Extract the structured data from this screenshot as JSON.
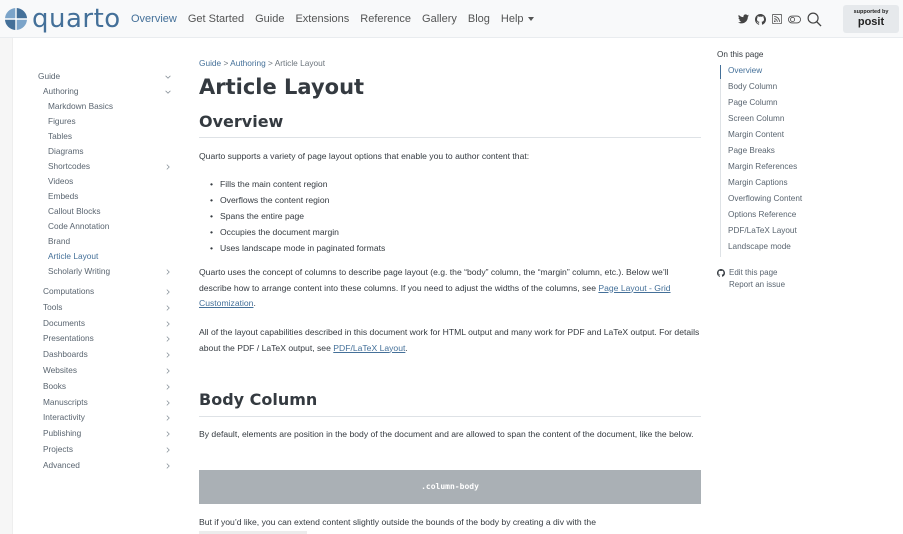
{
  "navbar": {
    "brand": "quarto",
    "links": [
      "Overview",
      "Get Started",
      "Guide",
      "Extensions",
      "Reference",
      "Gallery",
      "Blog",
      "Help"
    ],
    "active_link": "Overview",
    "icons": [
      "twitter-icon",
      "github-icon",
      "rss-icon",
      "reader-mode-toggle-icon",
      "search-icon"
    ],
    "badge_small": "supported by",
    "badge_big": "posit"
  },
  "sidebar": {
    "items": [
      {
        "label": "Guide",
        "level": 0,
        "chevron": "down"
      },
      {
        "label": "Authoring",
        "level": 1,
        "chevron": "down"
      },
      {
        "label": "Markdown Basics",
        "level": 2
      },
      {
        "label": "Figures",
        "level": 2
      },
      {
        "label": "Tables",
        "level": 2
      },
      {
        "label": "Diagrams",
        "level": 2
      },
      {
        "label": "Shortcodes",
        "level": 2,
        "chevron": "right"
      },
      {
        "label": "Videos",
        "level": 2
      },
      {
        "label": "Embeds",
        "level": 2
      },
      {
        "label": "Callout Blocks",
        "level": 2
      },
      {
        "label": "Code Annotation",
        "level": 2
      },
      {
        "label": "Brand",
        "level": 2
      },
      {
        "label": "Article Layout",
        "level": 2,
        "active": true
      },
      {
        "label": "Scholarly Writing",
        "level": 2,
        "chevron": "right"
      },
      {
        "label": "Computations",
        "level": 1,
        "chevron": "right"
      },
      {
        "label": "Tools",
        "level": 1,
        "chevron": "right"
      },
      {
        "label": "Documents",
        "level": 1,
        "chevron": "right"
      },
      {
        "label": "Presentations",
        "level": 1,
        "chevron": "right"
      },
      {
        "label": "Dashboards",
        "level": 1,
        "chevron": "right"
      },
      {
        "label": "Websites",
        "level": 1,
        "chevron": "right"
      },
      {
        "label": "Books",
        "level": 1,
        "chevron": "right"
      },
      {
        "label": "Manuscripts",
        "level": 1,
        "chevron": "right"
      },
      {
        "label": "Interactivity",
        "level": 1,
        "chevron": "right"
      },
      {
        "label": "Publishing",
        "level": 1,
        "chevron": "right"
      },
      {
        "label": "Projects",
        "level": 1,
        "chevron": "right"
      },
      {
        "label": "Advanced",
        "level": 1,
        "chevron": "right"
      }
    ]
  },
  "main": {
    "breadcrumb": [
      "Guide",
      "Authoring",
      "Article Layout"
    ],
    "breadcrumb_sep": ">",
    "title": "Article Layout",
    "overview_heading": "Overview",
    "intro": "Quarto supports a variety of page layout options that enable you to author content that:",
    "bullets": [
      "Fills the main content region",
      "Overflows the content region",
      "Spans the entire page",
      "Occupies the document margin",
      "Uses landscape mode in paginated formats"
    ],
    "columns_para_1": "Quarto uses the concept of columns to describe page layout (e.g. the “body” column, the “margin” column, etc.). Below we’ll describe how to arrange content into these columns. If you need to adjust the widths of the columns, see ",
    "columns_link": "Page Layout - Grid Customization",
    "columns_para_end": ".",
    "capabilities_para": "All of the layout capabilities described in this document work for HTML output and many work for PDF and LaTeX output. For details about the PDF / LaTeX output, see ",
    "capabilities_link": "PDF/LaTeX Layout",
    "capabilities_end": ".",
    "body_heading": "Body Column",
    "body_para": "By default, elements are position in the body of the document and are allowed to span the content of the document, like the below.",
    "body_demo": ".column-body",
    "extend_para": "But if you’d like, you can extend content slightly outside the bounds of the body by creating a div with the"
  },
  "toc": {
    "heading": "On this page",
    "items": [
      "Overview",
      "Body Column",
      "Page Column",
      "Screen Column",
      "Margin Content",
      "Page Breaks",
      "Margin References",
      "Margin Captions",
      "Overflowing Content",
      "Options Reference",
      "PDF/LaTeX Layout",
      "Landscape mode"
    ],
    "active": "Overview",
    "edit": "Edit this page",
    "report": "Report an issue"
  },
  "colors": {
    "accent": "#447099",
    "navbar_bg": "#f8f9fa",
    "demo_bg": "#aab0b5"
  }
}
